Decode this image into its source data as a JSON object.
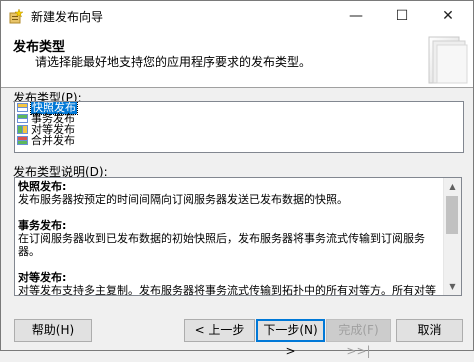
{
  "window": {
    "title": "新建发布向导",
    "minimize_glyph": "—",
    "maximize_glyph": "☐",
    "close_glyph": "✕"
  },
  "header": {
    "title": "发布类型",
    "subtitle": "请选择能最好地支持您的应用程序要求的发布类型。"
  },
  "publication_types": {
    "label": "发布类型(P):",
    "items": [
      {
        "label": "快照发布",
        "selected": true,
        "icon": "snapshot-publication-icon"
      },
      {
        "label": "事务发布",
        "selected": false,
        "icon": "transactional-publication-icon"
      },
      {
        "label": "对等发布",
        "selected": false,
        "icon": "peer-to-peer-publication-icon"
      },
      {
        "label": "合并发布",
        "selected": false,
        "icon": "merge-publication-icon"
      }
    ]
  },
  "description": {
    "label": "发布类型说明(D):",
    "sections": [
      {
        "heading": "快照发布:",
        "body": "发布服务器按预定的时间间隔向订阅服务器发送已发布数据的快照。"
      },
      {
        "heading": "事务发布:",
        "body": "在订阅服务器收到已发布数据的初始快照后，发布服务器将事务流式传输到订阅服务器。"
      },
      {
        "heading": "对等发布:",
        "body": "对等发布支持多主复制。发布服务器将事务流式传输到拓扑中的所有对等方。所有对等节点可以读取和写入更改，且所有更改将传播到拓扑中的所有节点。"
      }
    ]
  },
  "buttons": {
    "help": "帮助(H)",
    "back": "< 上一步",
    "next": "下一步(N) >",
    "finish": "完成(F) >>|",
    "cancel": "取消"
  },
  "colors": {
    "selection": "#0078d7",
    "window_bg": "#f0f0f0"
  }
}
